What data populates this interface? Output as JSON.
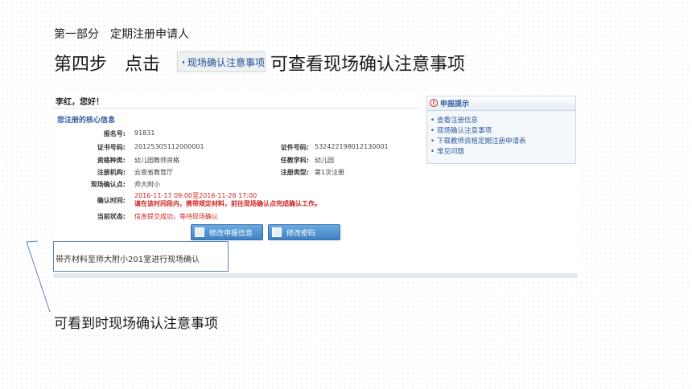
{
  "slide": {
    "section_title": "第一部分　定期注册申请人",
    "step_title_left": "第四步　点击",
    "step_link_label": "现场确认注意事项",
    "step_title_right": "可查看现场确认注意事项",
    "callout_text": "可看到时现场确认注意事项"
  },
  "panel": {
    "greeting": "李红，您好！",
    "core_title": "您注册的核心信息",
    "fields": {
      "report_no_label": "报名号:",
      "report_no_value": "91831",
      "cert_no_label": "证书号码:",
      "cert_no_value": "20125305112000001",
      "id_no_label": "证件号码:",
      "id_no_value": "532422198012130001",
      "qual_type_label": "资格种类:",
      "qual_type_value": "幼儿园教师资格",
      "subject_label": "任教学科:",
      "subject_value": "幼儿园",
      "authority_label": "注册机构:",
      "authority_value": "云南省教育厅",
      "reg_type_label": "注册类型:",
      "reg_type_value": "第1次注册",
      "site_label": "现场确认点:",
      "site_value": "师大附小",
      "confirm_time_label": "确认时间:",
      "confirm_time_value": "2016-11-17 09:00至2016-11-28 17:00",
      "confirm_time_note": "请在该时间段内，携带规定材料，前往现场确认点完成确认工作。",
      "status_label": "当前状态:",
      "status_value": "信息提交成功，等待现场确认"
    },
    "buttons": {
      "modify_info": "修改申报信息",
      "modify_pwd": "修改密码"
    },
    "note_text": "带齐材料至师大附小201室进行现场确认"
  },
  "tips": {
    "title": "申报提示",
    "items": [
      "查看注册信息",
      "现场确认注意事项",
      "下载教师资格定期注册申请表",
      "常见问题"
    ]
  },
  "colors": {
    "link_blue": "#2f5f9f",
    "alert_red": "#d2231f",
    "button_blue": "#3f82c6"
  }
}
